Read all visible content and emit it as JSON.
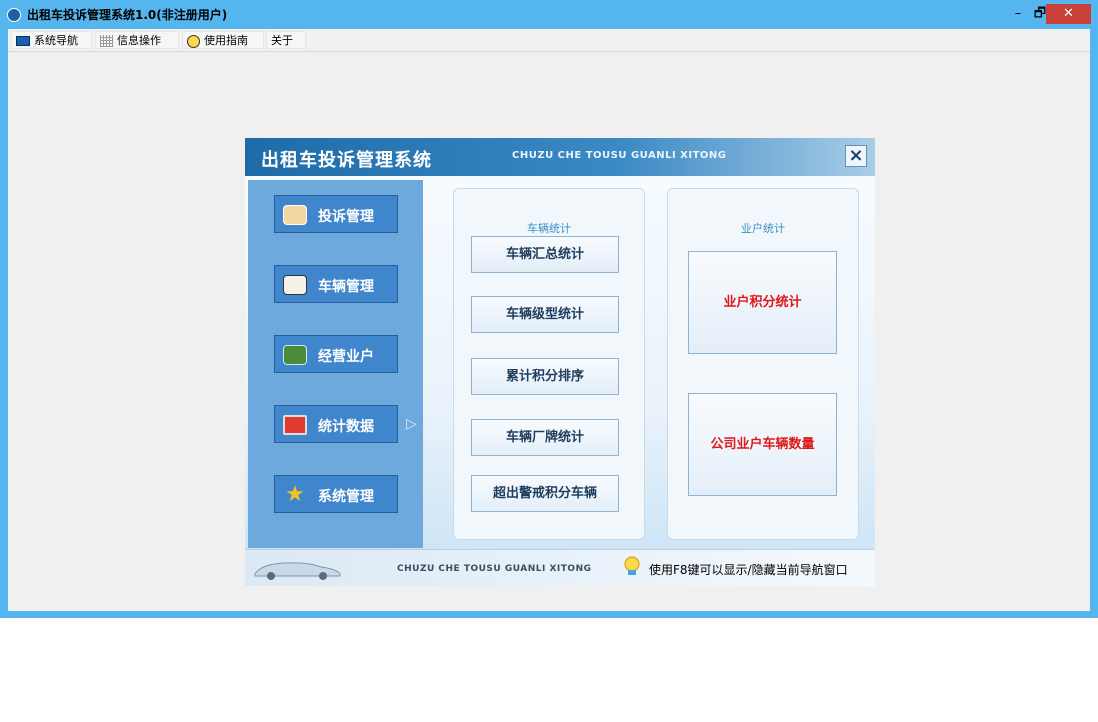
{
  "window": {
    "title": "出租车投诉管理系统1.0(非注册用户)",
    "controls": {
      "minimize": "–",
      "maximize": "🗗",
      "close": "✕"
    }
  },
  "menu": [
    {
      "label": "系统导航",
      "icon": "monitor-icon"
    },
    {
      "label": "信息操作",
      "icon": "grid-icon"
    },
    {
      "label": "使用指南",
      "icon": "bulb-icon"
    },
    {
      "label": "关于",
      "icon": ""
    }
  ],
  "dialog": {
    "title": "出租车投诉管理系统",
    "subtitle": "CHUZU CHE TOUSU GUANLI XITONG",
    "close": "×",
    "sidebar": [
      {
        "label": "投诉管理",
        "icon": "complaint-icon"
      },
      {
        "label": "车辆管理",
        "icon": "book-icon"
      },
      {
        "label": "经营业户",
        "icon": "owner-icon"
      },
      {
        "label": "统计数据",
        "icon": "monitor-red-icon"
      },
      {
        "label": "系统管理",
        "icon": "star-icon"
      }
    ],
    "selected_arrow": "▷",
    "vehicle_panel": {
      "label": "车辆统计",
      "buttons": [
        "车辆汇总统计",
        "车辆级型统计",
        "累计积分排序",
        "车辆厂牌统计",
        "超出警戒积分车辆"
      ]
    },
    "owner_panel": {
      "label": "业户统计",
      "buttons": [
        "业户积分统计",
        "公司业户车辆数量"
      ]
    },
    "footer": {
      "subtitle": "CHUZU CHE TOUSU GUANLI XITONG",
      "hint": "使用F8键可以显示/隐藏当前导航窗口"
    }
  },
  "colors": {
    "window_frame": "#55b6ef",
    "sidebar": "#6ea9dd",
    "sidebar_button": "#3f86cc",
    "highlight_text": "#e01818",
    "close_button": "#c7413a"
  }
}
